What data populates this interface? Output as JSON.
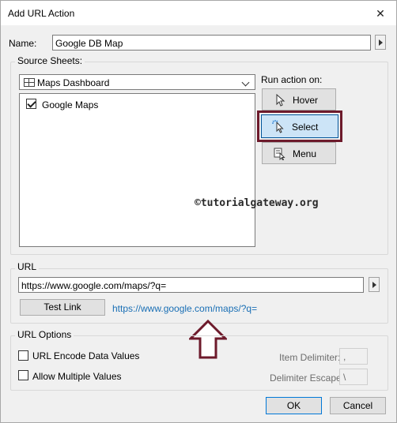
{
  "window": {
    "title": "Add URL Action",
    "close_glyph": "✕"
  },
  "name": {
    "label": "Name:",
    "value": "Google DB Map"
  },
  "source_sheets": {
    "group_label": "Source Sheets:",
    "dashboard_selected": "Maps Dashboard",
    "sheets": [
      {
        "label": "Google Maps",
        "checked": true
      }
    ]
  },
  "run_action": {
    "label": "Run action on:",
    "buttons": [
      {
        "label": "Hover",
        "icon": "cursor-icon"
      },
      {
        "label": "Select",
        "icon": "click-cursor-icon",
        "selected": true
      },
      {
        "label": "Menu",
        "icon": "menu-icon"
      }
    ]
  },
  "watermark": "©tutorialgateway.org",
  "url": {
    "group_label": "URL",
    "value": "https://www.google.com/maps/?q=",
    "test_link_label": "Test Link",
    "preview_link": "https://www.google.com/maps/?q="
  },
  "url_options": {
    "group_label": "URL Options",
    "encode_label": "URL Encode Data Values",
    "multiple_label": "Allow Multiple Values",
    "item_delimiter_label": "Item Delimiter:",
    "item_delimiter_value": ",",
    "delimiter_escape_label": "Delimiter Escape:",
    "delimiter_escape_value": "\\"
  },
  "footer": {
    "ok_label": "OK",
    "cancel_label": "Cancel"
  },
  "colors": {
    "accent": "#0078d7",
    "highlight_frame": "#6d1a2b",
    "link": "#1a6fb5"
  }
}
